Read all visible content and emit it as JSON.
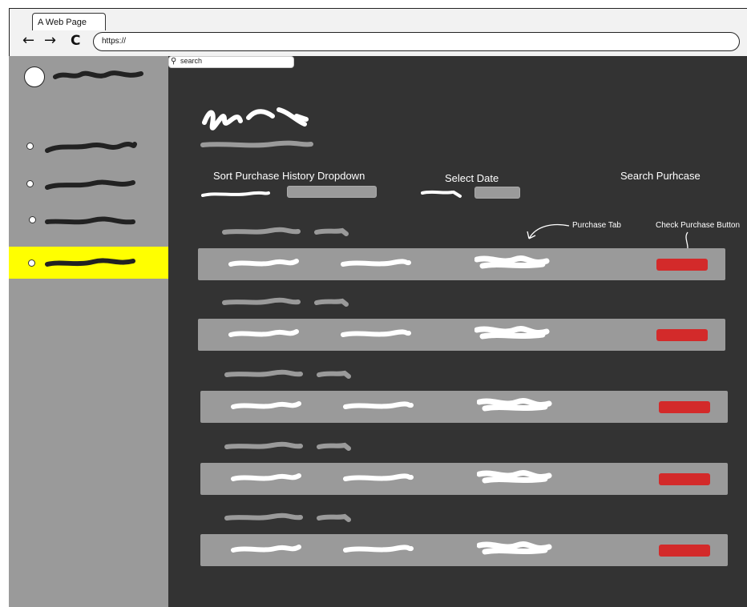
{
  "browser": {
    "tab_title": "A Web Page",
    "back_icon": "←",
    "forward_icon": "→",
    "reload_icon": "C",
    "url": "https://"
  },
  "main": {
    "sort_label": "Sort Purchase History Dropdown",
    "date_label": "Select Date",
    "search_label": "Search Purhcase",
    "search_placeholder": "search",
    "annotation_purchase_tab": "Purchase Tab",
    "annotation_check_button": "Check Purchase Button"
  },
  "colors": {
    "sidebar": "#9a9a9a",
    "main_background": "#333333",
    "active_item": "#ffff00",
    "check_button": "#d32a2a",
    "row": "#9a9a9a"
  },
  "icons": [
    "arrow-left-icon",
    "arrow-right-icon",
    "reload-icon",
    "search-icon"
  ]
}
